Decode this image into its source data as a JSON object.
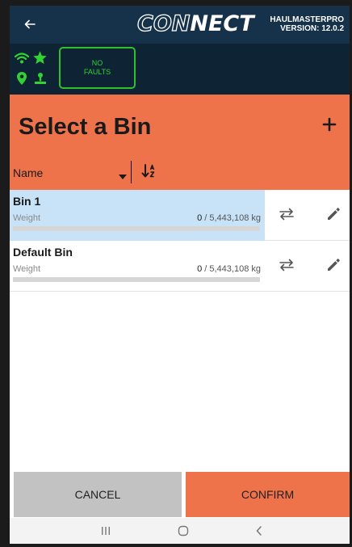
{
  "header": {
    "logo_left": "CON",
    "logo_right": "NECT",
    "app_name": "HAULMASTERPRO",
    "version": "VERSION: 12.0.2"
  },
  "status": {
    "faults_line1": "NO",
    "faults_line2": "FAULTS",
    "indicator_color": "#31d231"
  },
  "page": {
    "title": "Select a Bin"
  },
  "sort": {
    "field_label": "Name"
  },
  "bins": [
    {
      "name": "Bin 1",
      "weight_label": "Weight",
      "current": "0",
      "capacity": "5,443,108",
      "unit": "kg",
      "selected": true,
      "fill_fraction": 0
    },
    {
      "name": "Default Bin",
      "weight_label": "Weight",
      "current": "0",
      "capacity": "5,443,108",
      "unit": "kg",
      "selected": false,
      "fill_fraction": 0
    }
  ],
  "footer": {
    "cancel_label": "CANCEL",
    "confirm_label": "CONFIRM"
  },
  "colors": {
    "header_bg": "#15324a",
    "status_bg": "#0e2435",
    "accent": "#ee734a",
    "selected_row": "#c8e3f7",
    "ok_green": "#31d231"
  },
  "icons": {
    "back": "arrow-left-icon",
    "wifi": "wifi-icon",
    "star": "star-icon",
    "location": "location-pin-icon",
    "operator": "operator-icon",
    "add": "plus-icon",
    "caret": "caret-down-icon",
    "sort_direction": "sort-ascending-icon",
    "transfer": "swap-arrows-icon",
    "edit": "pencil-icon"
  }
}
